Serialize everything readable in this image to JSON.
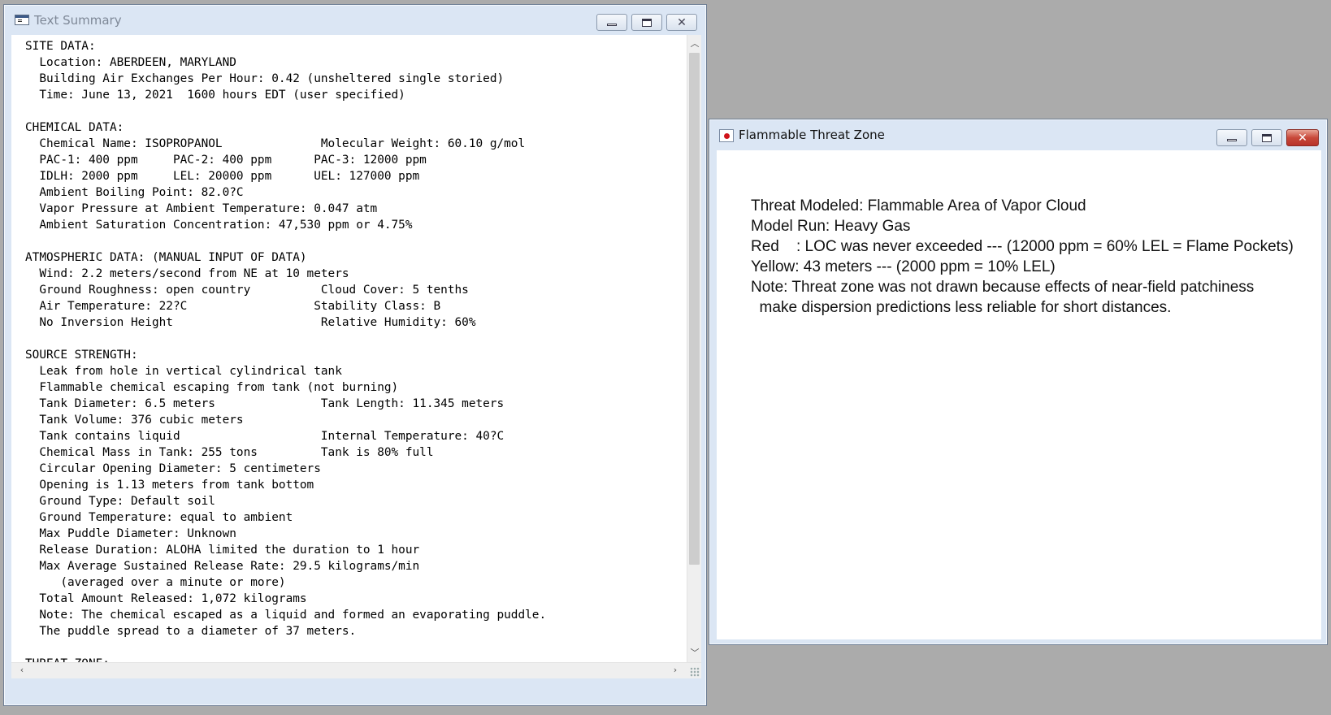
{
  "text_window": {
    "title": "Text Summary",
    "report_lines": [
      "SITE DATA:",
      "  Location: ABERDEEN, MARYLAND",
      "  Building Air Exchanges Per Hour: 0.42 (unsheltered single storied)",
      "  Time: June 13, 2021  1600 hours EDT (user specified)",
      "",
      "CHEMICAL DATA:",
      "  Chemical Name: ISOPROPANOL              Molecular Weight: 60.10 g/mol",
      "  PAC-1: 400 ppm     PAC-2: 400 ppm      PAC-3: 12000 ppm",
      "  IDLH: 2000 ppm     LEL: 20000 ppm      UEL: 127000 ppm",
      "  Ambient Boiling Point: 82.0?C",
      "  Vapor Pressure at Ambient Temperature: 0.047 atm",
      "  Ambient Saturation Concentration: 47,530 ppm or 4.75%",
      "",
      "ATMOSPHERIC DATA: (MANUAL INPUT OF DATA)",
      "  Wind: 2.2 meters/second from NE at 10 meters",
      "  Ground Roughness: open country          Cloud Cover: 5 tenths",
      "  Air Temperature: 22?C                  Stability Class: B",
      "  No Inversion Height                     Relative Humidity: 60%",
      "",
      "SOURCE STRENGTH:",
      "  Leak from hole in vertical cylindrical tank",
      "  Flammable chemical escaping from tank (not burning)",
      "  Tank Diameter: 6.5 meters               Tank Length: 11.345 meters",
      "  Tank Volume: 376 cubic meters",
      "  Tank contains liquid                    Internal Temperature: 40?C",
      "  Chemical Mass in Tank: 255 tons         Tank is 80% full",
      "  Circular Opening Diameter: 5 centimeters",
      "  Opening is 1.13 meters from tank bottom",
      "  Ground Type: Default soil",
      "  Ground Temperature: equal to ambient",
      "  Max Puddle Diameter: Unknown",
      "  Release Duration: ALOHA limited the duration to 1 hour",
      "  Max Average Sustained Release Rate: 29.5 kilograms/min",
      "     (averaged over a minute or more)",
      "  Total Amount Released: 1,072 kilograms",
      "  Note: The chemical escaped as a liquid and formed an evaporating puddle.",
      "  The puddle spread to a diameter of 37 meters.",
      "",
      "THREAT ZONE:"
    ]
  },
  "threat_window": {
    "title": "Flammable Threat Zone",
    "lines": [
      "Threat Modeled: Flammable Area of Vapor Cloud",
      "Model Run: Heavy Gas",
      "Red    : LOC was never exceeded --- (12000 ppm = 60% LEL = Flame Pockets)",
      "Yellow: 43 meters --- (2000 ppm = 10% LEL)",
      "Note: Threat zone was not drawn because effects of near-field patchiness",
      "  make dispersion predictions less reliable for short distances."
    ]
  },
  "icons": {
    "minimize": "minimize-icon",
    "maximize": "maximize-icon",
    "close": "close-icon"
  }
}
